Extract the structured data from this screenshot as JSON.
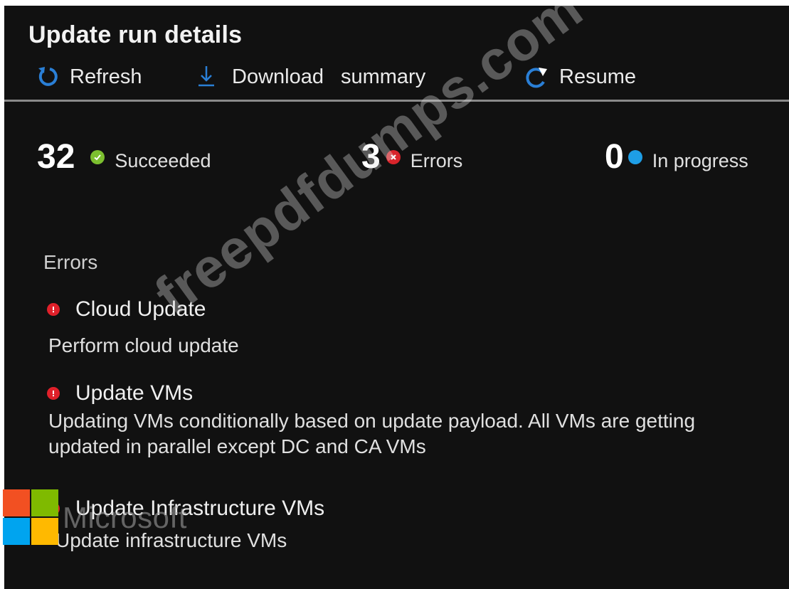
{
  "header": {
    "title": "Update run details"
  },
  "toolbar": {
    "refresh_label": "Refresh",
    "download_label": "Download",
    "download_label_2": "summary",
    "resume_label": "Resume"
  },
  "stats": {
    "succeeded": {
      "count": "32",
      "label": "Succeeded",
      "color": "#7cbf2f"
    },
    "errors": {
      "count": "3",
      "label": "Errors",
      "color": "#d8242b"
    },
    "in_progress": {
      "count": "0",
      "label": "In progress",
      "color": "#1e9ee6"
    }
  },
  "errors_section": {
    "heading": "Errors",
    "items": [
      {
        "title": "Cloud Update",
        "description": "Perform cloud update"
      },
      {
        "title": "Update VMs",
        "description_line1": "Updating VMs conditionally based on update payload. All VMs are getting",
        "description_line2": "updated in parallel except DC and CA VMs"
      },
      {
        "title": "Update Infrastructure VMs",
        "description": "Update infrastructure VMs"
      }
    ]
  },
  "overlay": {
    "watermark": "freepdfdumps.com",
    "logo_text": "Microsoft",
    "logo_colors": [
      "#f25022",
      "#7fba00",
      "#00a4ef",
      "#ffb900"
    ]
  },
  "colors": {
    "background": "#111111",
    "accent": "#2a7fd6",
    "error": "#e0202a"
  }
}
